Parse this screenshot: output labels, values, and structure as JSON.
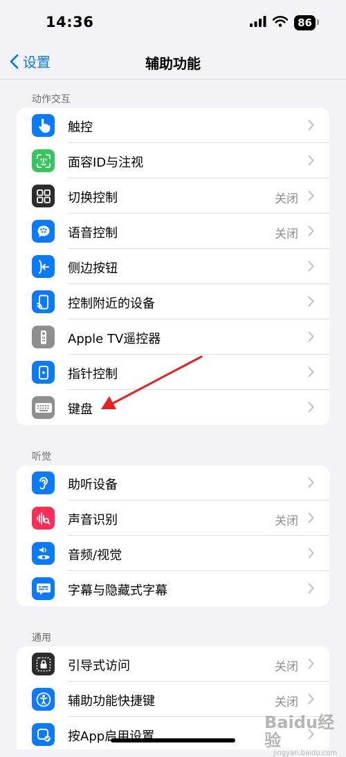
{
  "status": {
    "time": "14:36",
    "battery": "86"
  },
  "nav": {
    "back_label": "设置",
    "title": "辅助功能"
  },
  "sections": [
    {
      "header": "动作交互",
      "rows": [
        {
          "label": "触控",
          "value": "",
          "color": "#0a7aff",
          "icon": "hand-pointer-icon"
        },
        {
          "label": "面容ID与注视",
          "value": "",
          "color": "#34c759",
          "icon": "face-id-icon"
        },
        {
          "label": "切换控制",
          "value": "关闭",
          "color": "#2c2c2e",
          "icon": "grid-icon"
        },
        {
          "label": "语音控制",
          "value": "关闭",
          "color": "#0a7aff",
          "icon": "voice-control-icon"
        },
        {
          "label": "侧边按钮",
          "value": "",
          "color": "#0a7aff",
          "icon": "side-button-icon"
        },
        {
          "label": "控制附近的设备",
          "value": "",
          "color": "#0a7aff",
          "icon": "nearby-devices-icon"
        },
        {
          "label": "Apple TV遥控器",
          "value": "",
          "color": "#8e8e93",
          "icon": "remote-icon"
        },
        {
          "label": "指针控制",
          "value": "",
          "color": "#0a7aff",
          "icon": "pointer-icon"
        },
        {
          "label": "键盘",
          "value": "",
          "color": "#8e8e93",
          "icon": "keyboard-icon"
        }
      ]
    },
    {
      "header": "听觉",
      "rows": [
        {
          "label": "助听设备",
          "value": "",
          "color": "#0a7aff",
          "icon": "ear-icon"
        },
        {
          "label": "声音识别",
          "value": "关闭",
          "color": "#ff2d55",
          "icon": "sound-recognition-icon"
        },
        {
          "label": "音频/视觉",
          "value": "",
          "color": "#0a7aff",
          "icon": "audio-visual-icon"
        },
        {
          "label": "字幕与隐藏式字幕",
          "value": "",
          "color": "#0a7aff",
          "icon": "subtitles-icon"
        }
      ]
    },
    {
      "header": "通用",
      "rows": [
        {
          "label": "引导式访问",
          "value": "关闭",
          "color": "#2c2c2e",
          "icon": "guided-access-icon"
        },
        {
          "label": "辅助功能快捷键",
          "value": "关闭",
          "color": "#0a7aff",
          "icon": "accessibility-icon"
        },
        {
          "label": "按App启用设置",
          "value": "",
          "color": "#0a7aff",
          "icon": "per-app-settings-icon"
        }
      ]
    }
  ],
  "watermark": {
    "logo": "Baidu经验",
    "url": "jingyan.baidu.com"
  }
}
